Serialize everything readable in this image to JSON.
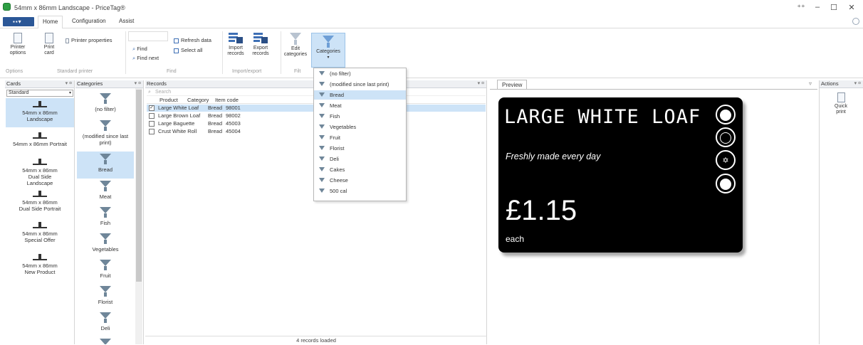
{
  "window": {
    "title": "54mm x 86mm Landscape - PriceTag®",
    "controls": [
      "⁺⁺",
      "–",
      "☐",
      "✕"
    ]
  },
  "ribbon_tabs": {
    "file": "▪▪▾",
    "home": "Home",
    "configuration": "Configuration",
    "assist": "Assist"
  },
  "ribbon": {
    "printer_options": "Printer options",
    "print_card": "Print card",
    "printer_properties": "Printer properties",
    "find": "Find",
    "find_next": "Find next",
    "refresh_data": "Refresh data",
    "select_all": "Select all",
    "import_records": "Import records",
    "export_records": "Export records",
    "edit_categories": "Edit categories",
    "categories": "Categories",
    "groups": {
      "options": "Options",
      "standard_printer": "Standard printer",
      "find": "Find",
      "import_export": "Import/export",
      "filter": "Filt"
    }
  },
  "cards_panel": {
    "title": "Cards",
    "combo_value": "Standard",
    "items": [
      "54mm x 86mm Landscape",
      "54mm x 86mm Portrait",
      "54mm x 86mm Dual Side Landscape",
      "54mm x 86mm Dual Side Portrait",
      "54mm x 86mm Special Offer",
      "54mm x 86mm New Product"
    ]
  },
  "categories_panel": {
    "title": "Categories",
    "items": [
      "(no filter)",
      "(modified since last print)",
      "Bread",
      "Meat",
      "Fish",
      "Vegetables",
      "Fruit",
      "Florist",
      "Deli"
    ]
  },
  "records_panel": {
    "title": "Records",
    "search_placeholder": "Search",
    "columns": [
      "Product",
      "Category",
      "Item code"
    ],
    "rows": [
      {
        "product": "Large White Loaf",
        "category": "Bread",
        "code": "98001",
        "checked": "✓"
      },
      {
        "product": "Large Brown Loaf",
        "category": "Bread",
        "code": "98002",
        "checked": ""
      },
      {
        "product": "Large Baguette",
        "category": "Bread",
        "code": "45003",
        "checked": ""
      },
      {
        "product": "Crust White Roll",
        "category": "Bread",
        "code": "45004",
        "checked": ""
      }
    ],
    "status": "4 records loaded"
  },
  "dropdown": {
    "items": [
      "(no filter)",
      "(modified since last print)",
      "Bread",
      "Meat",
      "Fish",
      "Vegetables",
      "Fruit",
      "Florist",
      "Deli",
      "Cakes",
      "Cheese",
      "500 cal"
    ]
  },
  "preview": {
    "tab": "Preview",
    "card": {
      "product": "LARGE WHITE LOAF",
      "tagline": "Freshly made every day",
      "price": "£1.15",
      "unit": "each",
      "badges": [
        "vegan",
        "halal",
        "kosher",
        "vegetarian"
      ]
    }
  },
  "actions_panel": {
    "title": "Actions",
    "quick_print": "Quick print"
  }
}
